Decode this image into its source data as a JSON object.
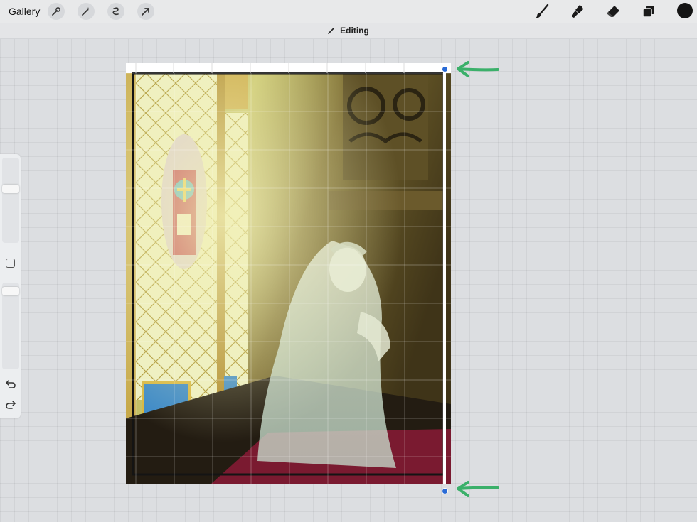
{
  "topbar": {
    "gallery_label": "Gallery",
    "left_tools": [
      "wrench-icon",
      "magic-wand-icon",
      "selection-icon",
      "transform-arrow-icon"
    ],
    "right_tools": [
      "brush-icon",
      "smudge-icon",
      "eraser-icon",
      "layers-icon"
    ],
    "current_color": "#141414"
  },
  "status": {
    "label": "Editing"
  },
  "sidebar": {
    "brush_size_level": 0.35,
    "opacity_level": 0.05,
    "undo_icon": "undo-icon",
    "redo_icon": "redo-icon"
  },
  "colors": {
    "annotation_arrow": "#3bb06a",
    "handle": "#2a6bd6"
  }
}
